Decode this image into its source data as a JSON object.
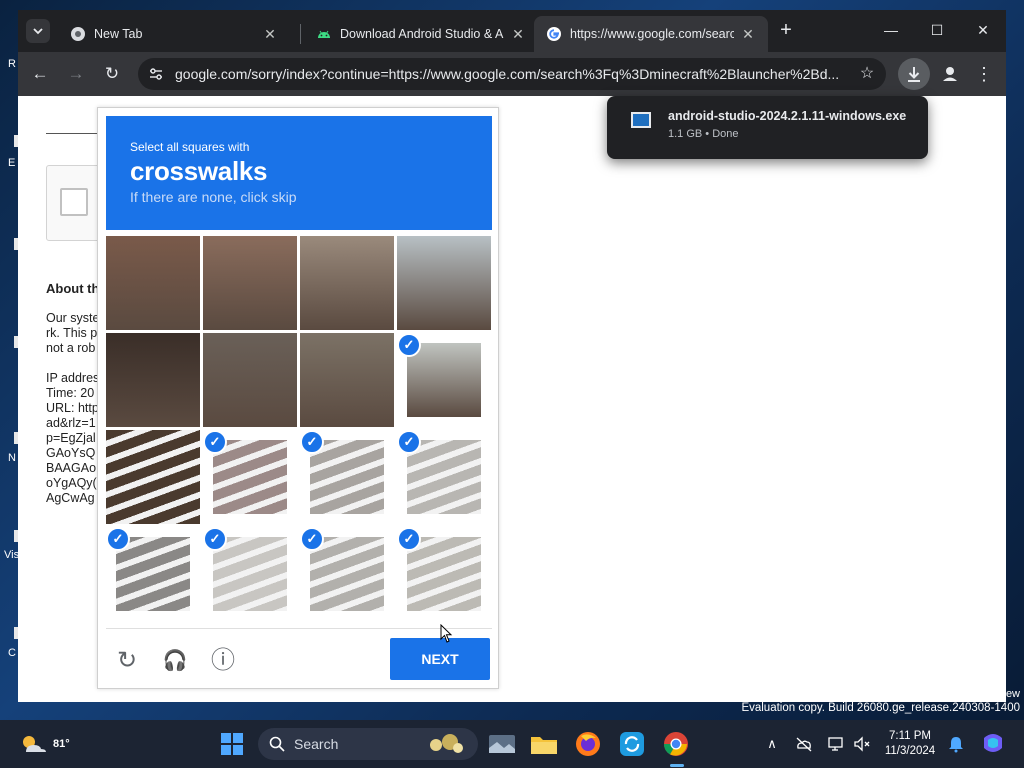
{
  "desktop": {
    "left_icon_letters": [
      "R",
      "E",
      "N",
      "Vis",
      "C"
    ]
  },
  "browser": {
    "tabs": [
      {
        "title": "New Tab",
        "favicon": "chrome-icon",
        "active": false
      },
      {
        "title": "Download Android Studio & Ap",
        "favicon": "android-icon",
        "active": false
      },
      {
        "title": "https://www.google.com/searcl",
        "favicon": "google-icon",
        "active": true
      }
    ],
    "close_glyph": "✕",
    "new_tab_glyph": "+",
    "window_controls": {
      "minimize": "—",
      "maximize": "☐",
      "close": "✕"
    },
    "nav": {
      "back": "←",
      "forward": "→",
      "reload": "↻"
    },
    "address": "google.com/sorry/index?continue=https://www.google.com/search%3Fq%3Dminecraft%2Blauncher%2Bd...",
    "bookmark_glyph": "☆",
    "menu_glyph": "⋮"
  },
  "page": {
    "heading_partial": "About th",
    "lines": [
      "Our syste",
      "rk. This p",
      "not a rob",
      "",
      "IP addres",
      "Time: 20",
      "URL: http",
      "ad&rlz=1",
      "p=EgZjal",
      "GAoYsQ",
      "BAAGAo",
      "oYgAQy(",
      "AgCwAg"
    ]
  },
  "download": {
    "filename": "android-studio-2024.2.1.11-windows.exe",
    "meta": "1.1 GB • Done"
  },
  "captcha": {
    "intro": "Select all squares with",
    "keyword": "crosswalks",
    "hint": "If there are none, click skip",
    "selected": [
      false,
      false,
      false,
      false,
      false,
      false,
      false,
      true,
      false,
      true,
      true,
      true,
      true,
      true,
      true,
      true
    ],
    "tile_colors": [
      "#7a5a4a",
      "#8a6c5c",
      "#9a8a7c",
      "#b8c0c4",
      "#3a2e28",
      "#6a6058",
      "#7c7266",
      "#c0c4c0",
      "#4a3a2e",
      "#9c8a88",
      "#a8a4a0",
      "#b8b6b2",
      "#8a8886",
      "#c8c6c2",
      "#b2b0ac",
      "#bcbab4"
    ],
    "check_glyph": "✓",
    "reload_glyph": "↻",
    "audio_glyph": "🎧",
    "info_glyph": "ⓘ",
    "next_label": "NEXT"
  },
  "watermark": {
    "top": "ew",
    "line": "Evaluation copy. Build 26080.ge_release.240308-1400"
  },
  "taskbar": {
    "weather_temp": "81°",
    "search_label": "Search",
    "clock_time": "7:11 PM",
    "clock_date": "11/3/2024",
    "chevron": "∧",
    "accent_colors": {
      "start": "#4fa8ff",
      "edge": "#0f7ed9",
      "firefox": "#ff7a1a",
      "chrome": "#2db84c"
    }
  }
}
